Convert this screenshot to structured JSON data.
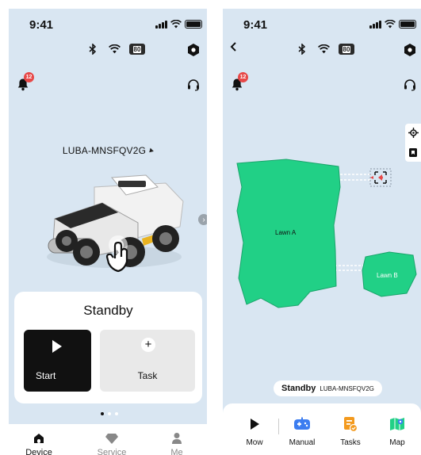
{
  "status_bar": {
    "time": "9:41"
  },
  "connection": {
    "battery_level": "80"
  },
  "notifications": {
    "count": "12"
  },
  "device": {
    "name": "LUBA-MNSFQV2G",
    "state": "Standby"
  },
  "home_panel": {
    "start_label": "Start",
    "task_label": "Task",
    "task_plus": "+"
  },
  "carousel": {
    "pages": 3,
    "active": 0
  },
  "tabs": [
    {
      "label": "Device",
      "active": true
    },
    {
      "label": "Service",
      "active": false
    },
    {
      "label": "Me",
      "active": false
    }
  ],
  "map": {
    "zones": [
      {
        "label": "Lawn A"
      },
      {
        "label": "Lawn B"
      }
    ]
  },
  "actions": [
    {
      "label": "Mow",
      "icon": "play-icon"
    },
    {
      "label": "Manual",
      "icon": "gamepad-icon"
    },
    {
      "label": "Tasks",
      "icon": "tasks-icon"
    },
    {
      "label": "Map",
      "icon": "map-icon"
    }
  ],
  "colors": {
    "background": "#d9e6f2",
    "lawn": "#21d086",
    "badge": "#e74848",
    "accent_orange": "#f39a1e",
    "accent_blue": "#3c7df0"
  }
}
